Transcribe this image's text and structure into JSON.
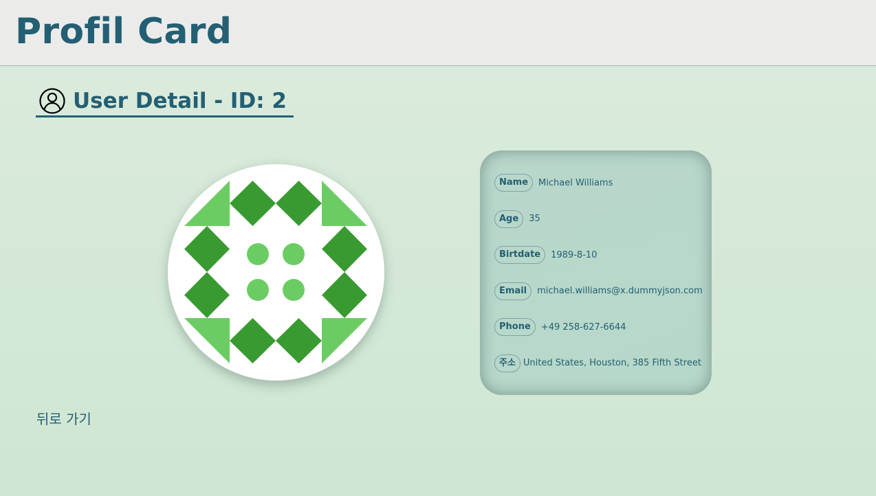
{
  "header": {
    "title": "Profil Card"
  },
  "section": {
    "title": "User Detail - ID: 2",
    "icon": "user-circle-icon"
  },
  "avatar": {
    "icon": "identicon-avatar",
    "fill_dark": "#3a9a32",
    "fill_light": "#6ccc64"
  },
  "card": {
    "fields": [
      {
        "label": "Name",
        "value": "Michael Williams"
      },
      {
        "label": "Age",
        "value": "35"
      },
      {
        "label": "Birtdate",
        "value": "1989-8-10"
      },
      {
        "label": "Email",
        "value": "michael.williams@x.dummyjson.com"
      },
      {
        "label": "Phone",
        "value": "+49 258-627-6644"
      },
      {
        "label": "주소",
        "value": "United States, Houston, 385 Fifth Street"
      }
    ]
  },
  "nav": {
    "back_label": "뒤로 가기"
  },
  "colors": {
    "accent": "#245f73",
    "header_bg": "#ebecea",
    "page_bg": "#d6e9d8"
  }
}
